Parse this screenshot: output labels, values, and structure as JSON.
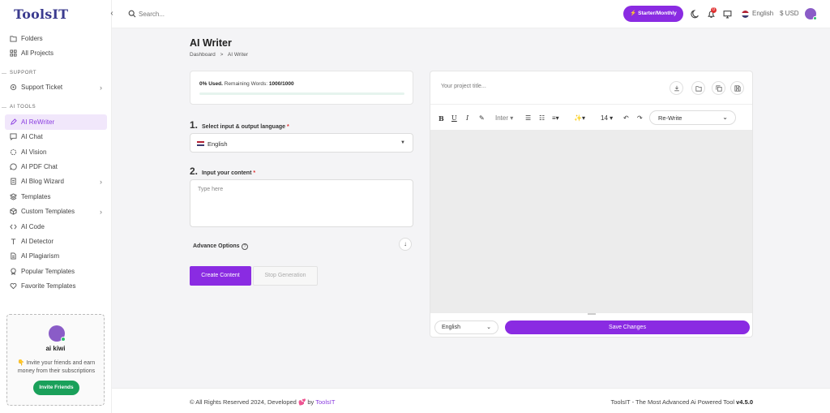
{
  "app": {
    "logo": "ToolsIT",
    "collapse_glyph": "‹"
  },
  "sidebar": {
    "top_items": [
      {
        "label": "Folders",
        "icon": "folder-icon"
      },
      {
        "label": "All Projects",
        "icon": "grid-icon"
      }
    ],
    "support_label": "SUPPORT",
    "support_items": [
      {
        "label": "Support Ticket",
        "icon": "gear-icon",
        "chevron": "›"
      }
    ],
    "ai_tools_label": "AI TOOLS",
    "ai_items": [
      {
        "label": "AI ReWriter",
        "icon": "pen-icon",
        "active": true
      },
      {
        "label": "AI Chat",
        "icon": "chat-icon"
      },
      {
        "label": "AI Vision",
        "icon": "vision-icon"
      },
      {
        "label": "AI PDF Chat",
        "icon": "pdf-chat-icon"
      },
      {
        "label": "AI Blog Wizard",
        "icon": "blog-icon",
        "chevron": "›"
      },
      {
        "label": "Templates",
        "icon": "layers-icon"
      },
      {
        "label": "Custom Templates",
        "icon": "cube-icon",
        "chevron": "›"
      },
      {
        "label": "AI Code",
        "icon": "code-icon"
      },
      {
        "label": "AI Detector",
        "icon": "text-icon"
      },
      {
        "label": "AI Plagiarism",
        "icon": "file-icon"
      },
      {
        "label": "Popular Templates",
        "icon": "medal-icon"
      },
      {
        "label": "Favorite Templates",
        "icon": "heart-icon"
      }
    ],
    "invite": {
      "name": "ai kiwi",
      "text": "👇 Invite your friends and earn money from their subscriptions",
      "button": "Invite Friends"
    }
  },
  "header": {
    "search_placeholder": "Search...",
    "plan_button": "⚡ Starter/Monthly",
    "notification_count": "0",
    "language": "English",
    "currency": "$ USD"
  },
  "main": {
    "title": "AI Writer",
    "breadcrumb": [
      "Dashboard",
      ">",
      "AI Writer"
    ],
    "usage": {
      "used_label": "0% Used.",
      "remaining_label": "Remaining Words:",
      "remaining_value": "1000/1000",
      "used_fraction": 0
    },
    "step1": {
      "num": "1.",
      "label": "Select input & output language",
      "req": "*"
    },
    "language_select": "English",
    "step2": {
      "num": "2.",
      "label": "Input your content",
      "req": "*"
    },
    "content_placeholder": "Type here",
    "advance_options": "Advance Options",
    "help_glyph": "?",
    "adv_toggle_glyph": "↓",
    "create_button": "Create Content",
    "stop_button": "Stop Generation"
  },
  "editor": {
    "title_placeholder": "Your project title...",
    "toolbar": {
      "bold": "B",
      "underline": "U",
      "italic": "I",
      "eraser": "✎",
      "font": "Inter ▾",
      "ul": "☰",
      "ol": "☷",
      "align": "≡▾",
      "magic": "✨▾",
      "size": "14 ▾",
      "undo": "↶",
      "redo": "↷",
      "mode": "Re-Write",
      "mode_caret": "⌄"
    },
    "language": "English",
    "language_caret": "⌄",
    "save_button": "Save Changes"
  },
  "footer": {
    "copyright": "© All Rights Reserved 2024, Developed",
    "heart": "💕",
    "by": "by",
    "brand": "ToolsIT",
    "tagline": "ToolsIT - The Most Advanced Ai Powered Tool",
    "version": "v4.5.0"
  },
  "colors": {
    "accent": "#8a2be2",
    "success": "#1aa05a",
    "logo": "#3b3b8f"
  }
}
